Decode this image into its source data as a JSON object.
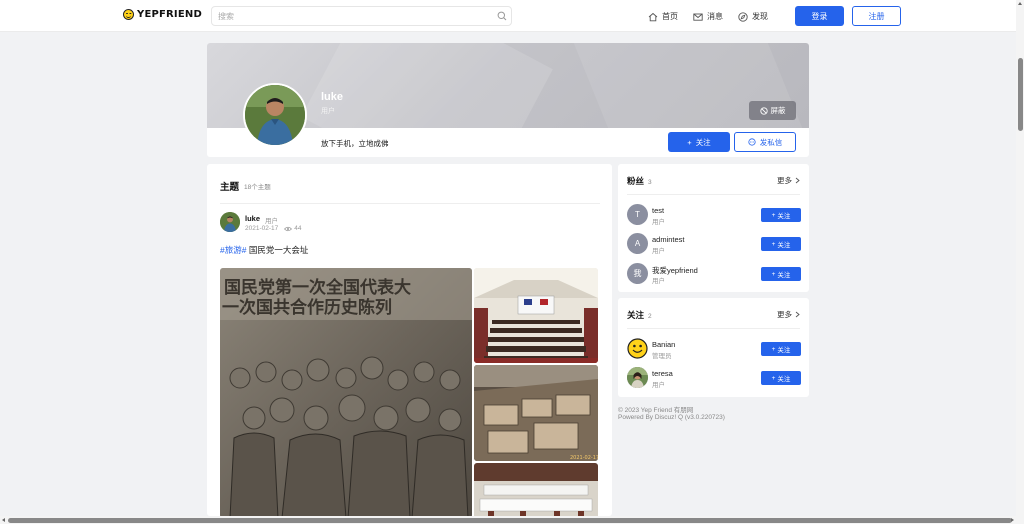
{
  "nav": {
    "logo_text": "YEPFRIEND",
    "search_placeholder": "搜索",
    "links": [
      {
        "label": "首页",
        "icon": "home-icon"
      },
      {
        "label": "消息",
        "icon": "mail-icon"
      },
      {
        "label": "发现",
        "icon": "compass-icon"
      }
    ],
    "login_label": "登录",
    "register_label": "注册"
  },
  "profile": {
    "name": "luke",
    "role": "用户",
    "bio": "放下手机，立地成佛",
    "block_label": "屏蔽",
    "follow_label": "关注",
    "message_label": "发私信"
  },
  "feed": {
    "title": "主题",
    "count_text": "18个主题",
    "post": {
      "author": "luke",
      "role": "用户",
      "date": "2021-02-17",
      "views": "44",
      "tag": "#旅游#",
      "text": "国民党一大会址",
      "image_caption": "国民党第一次全国代表大会 一次国共合作历史陈列"
    }
  },
  "fans": {
    "title": "粉丝",
    "count": "3",
    "more_label": "更多",
    "users": [
      {
        "avatar_text": "T",
        "name": "test",
        "role": "用户",
        "follow_label": "关注"
      },
      {
        "avatar_text": "A",
        "name": "admintest",
        "role": "用户",
        "follow_label": "关注"
      },
      {
        "avatar_text": "我",
        "name": "我爱yepfriend",
        "role": "用户",
        "follow_label": "关注"
      }
    ]
  },
  "following": {
    "title": "关注",
    "count": "2",
    "more_label": "更多",
    "users": [
      {
        "name": "Banian",
        "role": "管理员",
        "follow_label": "关注"
      },
      {
        "name": "teresa",
        "role": "用户",
        "follow_label": "关注"
      }
    ]
  },
  "footer": {
    "copyright": "© 2023 Yep Friend 有朋网",
    "powered": "Powered By Discuz! Q (v3.0.220723)"
  },
  "colors": {
    "accent": "#2563eb",
    "background": "#f1f2f4"
  }
}
